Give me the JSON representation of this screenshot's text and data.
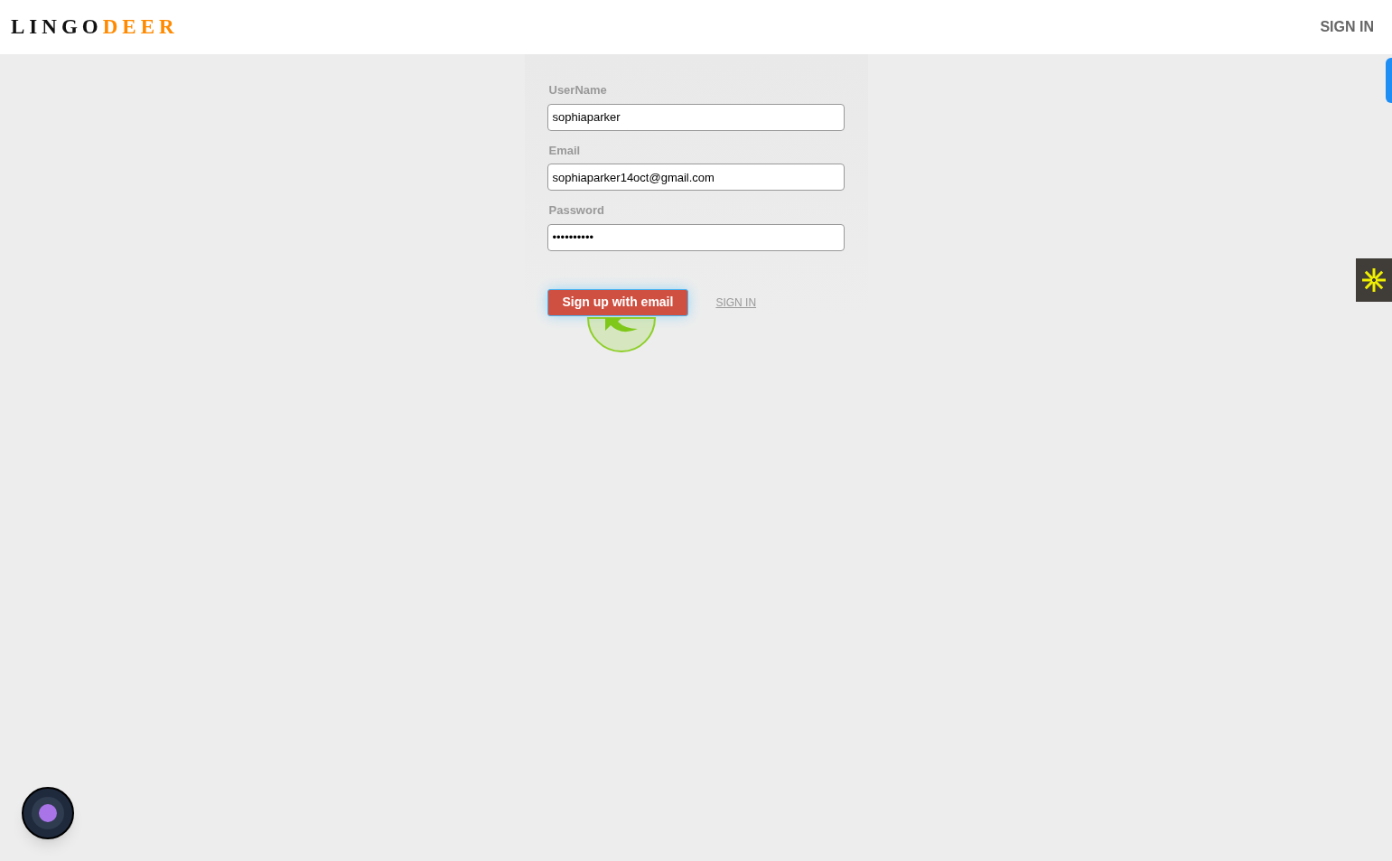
{
  "header": {
    "logo": {
      "first": "LINGO",
      "second": "DEER"
    },
    "sign_in": "SIGN IN"
  },
  "form": {
    "fields": [
      {
        "label": "UserName",
        "value": "sophiaparker"
      },
      {
        "label": "Email",
        "value": "sophiaparker14oct@gmail.com"
      },
      {
        "label": "Password",
        "value": "••••••••••"
      }
    ],
    "submit": "Sign up with email",
    "sign_in_link": "SIGN IN"
  }
}
